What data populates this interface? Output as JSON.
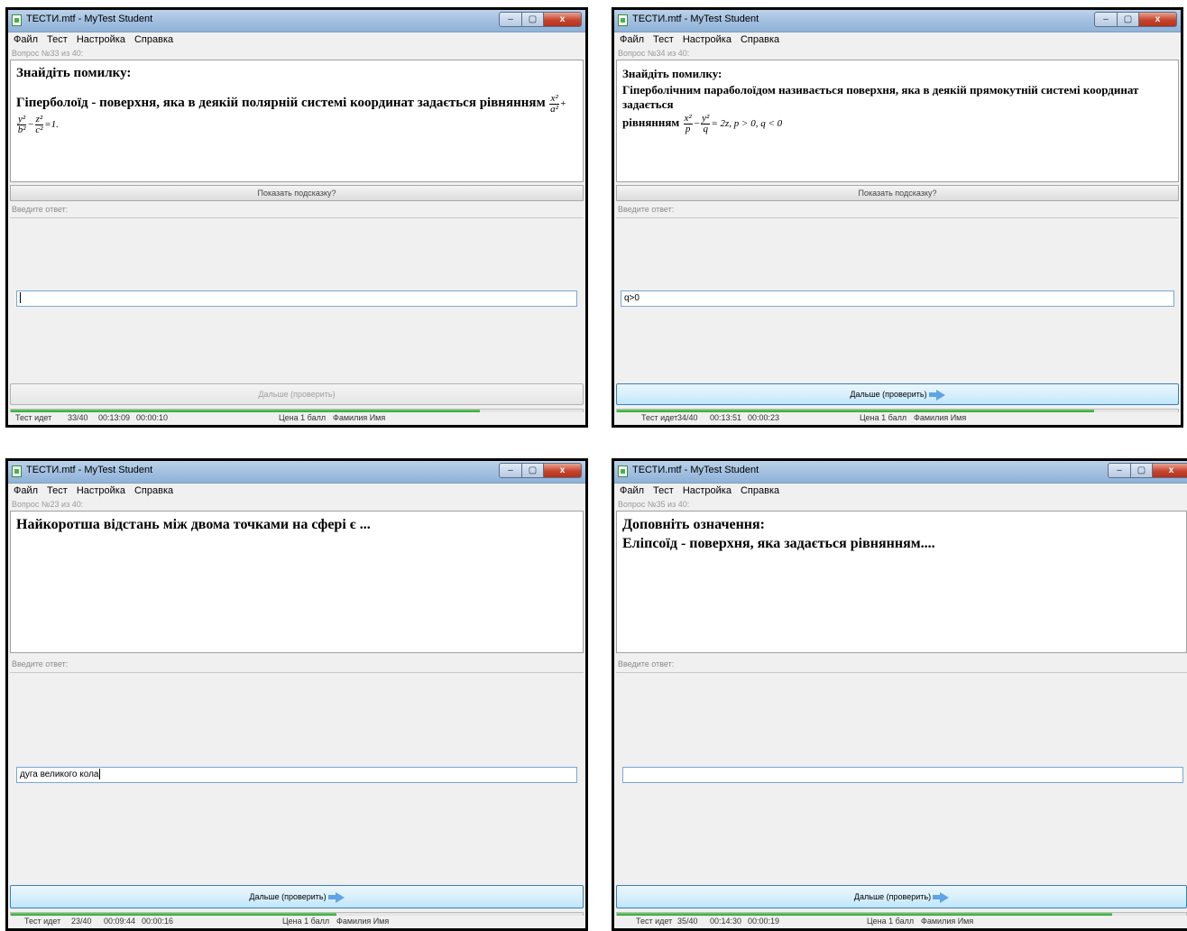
{
  "app_title": "ТЕСТИ.mtf - MyTest Student",
  "menu": [
    "Файл",
    "Тест",
    "Настройка",
    "Справка"
  ],
  "hint_label": "Показать подсказку?",
  "answer_label": "Введите ответ:",
  "next_label": "Дальше (проверить)",
  "status_state": "Тест идет",
  "price": "Цена 1 балл",
  "student": "Фамилия Имя",
  "window_buttons": {
    "minimize": "–",
    "maximize": "▢",
    "close": "x"
  },
  "windows": [
    {
      "qnum": "Вопрос №33 из 40:",
      "line1": "Знайдіть помилку:",
      "line2": "Гіперболоїд - поверхня, яка в деякій полярній системі координат задається рівнянням",
      "eq": {
        "f1n": "x²",
        "f1d": "a²",
        "op1": "+",
        "f2n": "y²",
        "f2d": "b²",
        "op2": "−",
        "f3n": "z²",
        "f3d": "c²",
        "rhs": "=1",
        "end": "."
      },
      "answer": "",
      "progress_pct": 82,
      "counter": "33/40",
      "time_total": "00:13:09",
      "time_q": "00:00:10"
    },
    {
      "qnum": "Вопрос №34 из 40:",
      "line1": "Знайдіть помилку:",
      "line2": "Гіперболічним параболоїдом називається поверхня, яка в деякій прямокутній системі координат задається",
      "line3": "рівнянням",
      "eq": {
        "f1n": "x²",
        "f1d": "p",
        "op1": "−",
        "f2n": "y²",
        "f2d": "q",
        "rhs": "= 2z",
        "cond": ", p > 0, q < 0"
      },
      "answer": "q>0",
      "progress_pct": 85,
      "counter": "34/40",
      "time_total": "00:13:51",
      "time_q": "00:00:23"
    },
    {
      "qnum": "Вопрос №23 из 40:",
      "line1": "Найкоротша відстань між двома точками на сфері є ...",
      "answer": "дуга великого кола",
      "progress_pct": 57,
      "counter": "23/40",
      "time_total": "00:09:44",
      "time_q": "00:00:16"
    },
    {
      "qnum": "Вопрос №35 из 40:",
      "line1": "Доповніть означення:",
      "line2": "Еліпсоїд - поверхня, яка задається рівнянням....",
      "answer": "",
      "progress_pct": 87,
      "counter": "35/40",
      "time_total": "00:14:30",
      "time_q": "00:00:19"
    }
  ]
}
